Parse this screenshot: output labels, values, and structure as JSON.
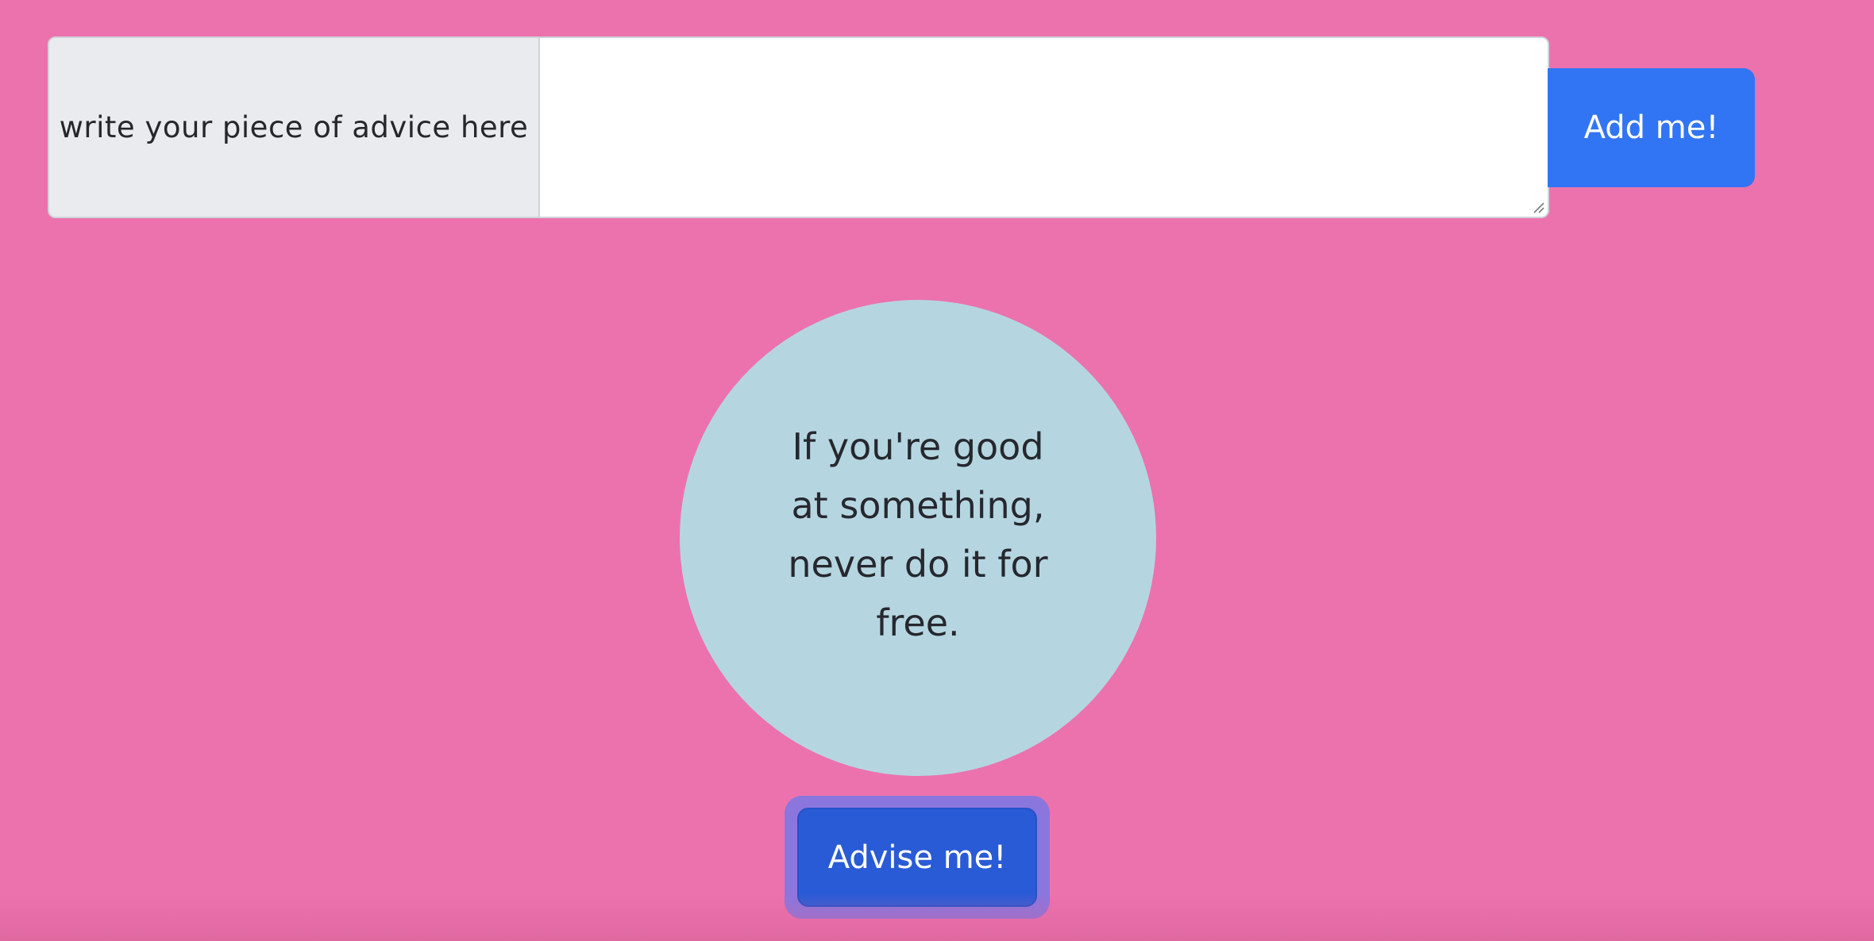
{
  "form": {
    "prefix_label": "write your piece of advice here",
    "textarea_value": "",
    "add_button_label": "Add me!"
  },
  "advice": {
    "text": "If you're good at something, never do it for free."
  },
  "actions": {
    "advise_button_label": "Advise me!"
  },
  "colors": {
    "background": "#ec72ad",
    "circle": "#b5d6e1",
    "add_button": "#3275f4",
    "advise_button": "#2a5bd6",
    "advise_outline": "#8b76de"
  }
}
